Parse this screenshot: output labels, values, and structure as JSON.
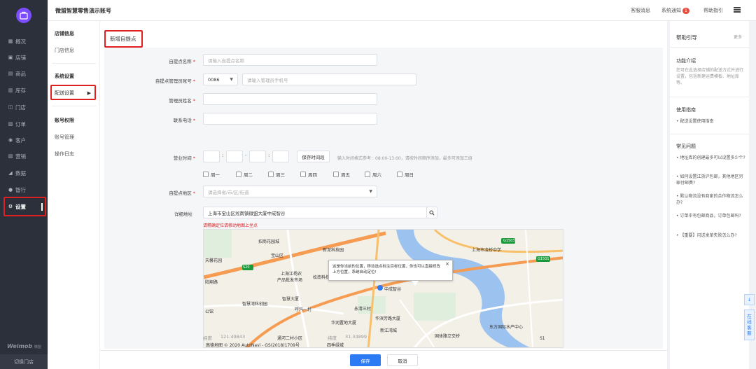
{
  "app": {
    "title": "微盟智慧零售演示账号",
    "brand": "Weimob",
    "brand_sub": "微盟",
    "switch_store": "切换门店"
  },
  "sidebar": {
    "items": [
      {
        "label": "概况",
        "icon": "▦"
      },
      {
        "label": "店铺",
        "icon": "▣"
      },
      {
        "label": "商品",
        "icon": "▤"
      },
      {
        "label": "库存",
        "icon": "▥"
      },
      {
        "label": "门店",
        "icon": "◫"
      },
      {
        "label": "订单",
        "icon": "▧"
      },
      {
        "label": "客户",
        "icon": "◉"
      },
      {
        "label": "营销",
        "icon": "▨"
      },
      {
        "label": "数据",
        "icon": "◢"
      },
      {
        "label": "智行",
        "icon": "●"
      },
      {
        "label": "设置",
        "icon": "⚙"
      }
    ]
  },
  "header": {
    "service": "客服消息",
    "notice": "系统通知",
    "notice_count": "1",
    "help": "帮助指引"
  },
  "subnav": {
    "group1": "店铺信息",
    "store_info": "门店信息",
    "group2": "系统设置",
    "delivery": "配送设置",
    "group3": "账号权限",
    "account": "账号管理",
    "log": "操作日志"
  },
  "form": {
    "page_title": "新增自提点",
    "name_label": "自提点名称",
    "name_placeholder": "请输入自提点名称",
    "phone_label": "自提点管理员账号",
    "country_code": "0086",
    "phone_placeholder": "请输入管理员手机号",
    "admin_label": "管理员姓名",
    "contact_label": "联系电话",
    "hours_label": "营业时间",
    "save_hours": "保存时间段",
    "hours_hint": "输入时间格式参考：08:00-13:00，请按时间顺序添加，最多可添加三组",
    "weekdays": [
      "周一",
      "周二",
      "周三",
      "周四",
      "周五",
      "周六",
      "周日"
    ],
    "region_label": "自提点地区",
    "region_placeholder": "请选择省/市/区/街道",
    "address_label": "详细地址",
    "address_value": "上海市宝山区淞南镇微盟大厦中成智谷",
    "address_warn": "请精确定位请移动地图上坐点",
    "lng_label": "经度",
    "lng_value": "121.49843",
    "lat_label": "纬度",
    "lat_value": "31.34899",
    "save": "保存",
    "cancel": "取消"
  },
  "map": {
    "popup": "这是你当前的位置，移动选点标注目标位置，你也可以直接修改上方位置，系统自动定位!",
    "copyright": "高德地图 © 2020 AutoNavi - GS(2018)1709号",
    "labels": [
      "招商花园城",
      "新泥科技园",
      "上海市凌桥中学",
      "天馨花园",
      "上海江杨农",
      "产品批发市场",
      "松南科技园",
      "宝山区",
      "中成智谷",
      "智慧大厦",
      "智慧湾科创园",
      "呼玛一村",
      "永清三村",
      "华润置地大厦",
      "华滨芳路大厦",
      "新江湾城",
      "东方国际水产中心",
      "通河二村小区",
      "四季绿城",
      "国体路立交桥",
      "S20",
      "G1503",
      "G1501",
      "S1",
      "公馆",
      "陆翔路"
    ]
  },
  "help": {
    "title": "帮助引导",
    "more": "更多",
    "intro_title": "功能介绍",
    "intro_text": "您可在此选择店铺的配送方式并进行设置，包括新建运费模板、地址库等。",
    "guide_title": "使用指南",
    "guide_item": "• 配送设置使用指南",
    "faq_title": "常见问题",
    "faqs": [
      "• 地址库的创建最多可以设置多少个?",
      "• 如何设置江浙沪包邮，其他地区另家付邮费?",
      "• 默认物流没有商家的合作物流怎么办?",
      "• 订单中有包邮商品，订单包邮吗?",
      "• 【重要】闪送发单失败怎么办?"
    ],
    "tab1": "↓",
    "tab2": "在线客服"
  }
}
